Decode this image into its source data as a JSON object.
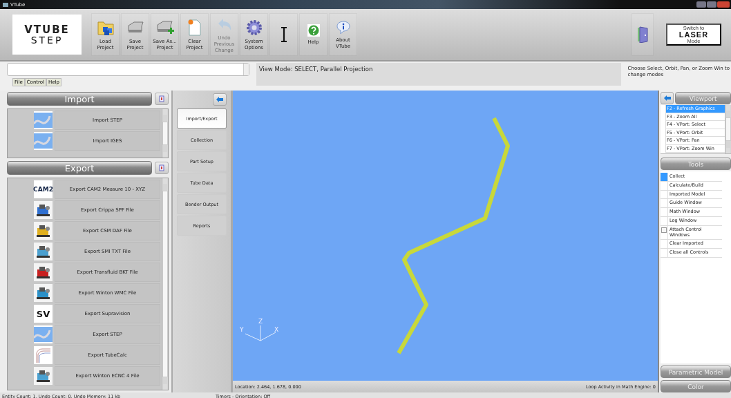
{
  "window": {
    "title": "VTube"
  },
  "logo": {
    "line1": "VTUBE",
    "line2": "STEP"
  },
  "toolbar": [
    {
      "label": "Load Project",
      "disabled": false
    },
    {
      "label": "Save Project",
      "disabled": false
    },
    {
      "label": "Save As... Project",
      "disabled": false
    },
    {
      "label": "Clear Project",
      "disabled": false
    },
    {
      "label": "Undo Previous Change",
      "disabled": true
    },
    {
      "label": "System Options",
      "disabled": false
    },
    {
      "disabled": false
    },
    {
      "label": "Help",
      "disabled": false
    },
    {
      "label": "About VTube",
      "disabled": false
    }
  ],
  "laser_logo": {
    "top": "Switch to",
    "main": "LASER",
    "bottom": "Mode"
  },
  "menu": [
    "File",
    "Control",
    "Help"
  ],
  "view_mode": "View Mode: SELECT, Parallel Projection",
  "hint": "Choose Select, Orbit, Pan, or Zoom Win to change modes",
  "import": {
    "title": "Import",
    "items": [
      {
        "label": "Import STEP",
        "kind": "curve"
      },
      {
        "label": "Import IGES",
        "kind": "curve"
      }
    ]
  },
  "export": {
    "title": "Export",
    "items": [
      {
        "label": "Export CAM2 Measure 10 - XYZ",
        "kind": "logo",
        "thumb_text": "CAM2"
      },
      {
        "label": "Export Crippa SPF File",
        "kind": "machine"
      },
      {
        "label": "Export CSM DAF File",
        "kind": "machine"
      },
      {
        "label": "Export SMI TXT File",
        "kind": "machine"
      },
      {
        "label": "Export Transfluid BKT File",
        "kind": "machine"
      },
      {
        "label": "Export Winton WMC File",
        "kind": "machine"
      },
      {
        "label": "Export Supravision",
        "kind": "logo",
        "thumb_text": "SV"
      },
      {
        "label": "Export STEP",
        "kind": "curve"
      },
      {
        "label": "Export TubeCalc",
        "kind": "sketch"
      },
      {
        "label": "Export Winton ECNC 4 File",
        "kind": "machine"
      }
    ]
  },
  "nav": [
    {
      "label": "Import/Export",
      "selected": true
    },
    {
      "label": "Collection",
      "selected": false
    },
    {
      "label": "Part Setup",
      "selected": false
    },
    {
      "label": "Tube Data",
      "selected": false
    },
    {
      "label": "Bender Output",
      "selected": false
    },
    {
      "label": "Reports",
      "selected": false
    }
  ],
  "viewport": {
    "axes": [
      "X",
      "Y",
      "Z"
    ],
    "location": "Location: 2.464, 1.678, 0.000",
    "loop_activity": "Loop Activity in Math Engine: 0"
  },
  "viewport_panel": {
    "title": "Viewport",
    "items": [
      {
        "label": "F2 - Refresh Graphics",
        "selected": true
      },
      {
        "label": "F3 - Zoom All",
        "selected": false
      },
      {
        "label": "F4 - VPort: Select",
        "selected": false
      },
      {
        "label": "F5 - VPort: Orbit",
        "selected": false
      },
      {
        "label": "F6 - VPort: Pan",
        "selected": false
      },
      {
        "label": "F7 - VPort: Zoom Win",
        "selected": false
      }
    ]
  },
  "tools": {
    "title": "Tools",
    "items": [
      {
        "label": "Collect",
        "kind": "command",
        "selected": true
      },
      {
        "label": "Calculate/Build",
        "kind": "command",
        "selected": false
      },
      {
        "label": "Imported Model",
        "kind": "command",
        "selected": false
      },
      {
        "label": "Guide Window",
        "kind": "command",
        "selected": false
      },
      {
        "label": "Math Window",
        "kind": "command",
        "selected": false
      },
      {
        "label": "Log Window",
        "kind": "command",
        "selected": false
      },
      {
        "label": "Attach Control Windows",
        "kind": "checkbox",
        "checked": false,
        "selected": false
      },
      {
        "label": "Clear Imported",
        "kind": "command",
        "selected": false
      },
      {
        "label": "Close all Controls",
        "kind": "command",
        "selected": false
      }
    ]
  },
  "bottom_panels": [
    "Parametric Model",
    "Color"
  ],
  "status_bar": {
    "left": "Entity Count: 1, Undo Count: 0, Undo Memory: 11 kb",
    "right": "Timers - Orientation: Off"
  }
}
